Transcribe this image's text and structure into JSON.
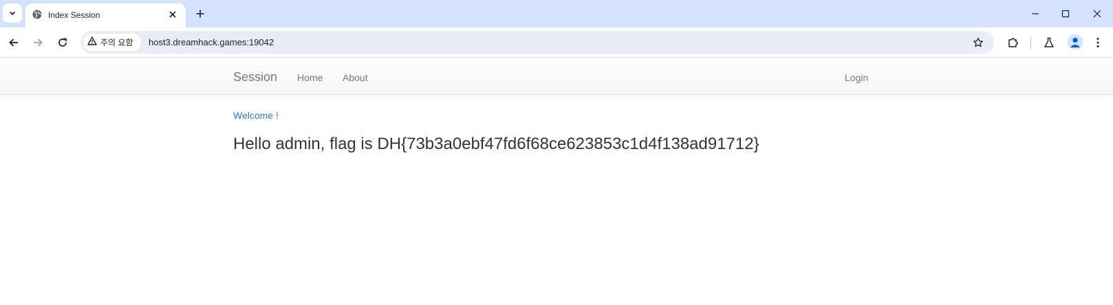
{
  "browser": {
    "tab": {
      "title": "Index Session"
    },
    "security_chip": {
      "label": "주의 요함"
    },
    "address": {
      "url": "host3.dreamhack.games:19042"
    }
  },
  "page": {
    "navbar": {
      "brand": "Session",
      "links": [
        "Home",
        "About"
      ],
      "login": "Login"
    },
    "welcome": "Welcome !",
    "message": "Hello admin, flag is DH{73b3a0ebf47fd6f68ce623853c1d4f138ad91712}"
  },
  "colors": {
    "tabstrip": "#d3e3fd",
    "omnibox": "#e9eef6",
    "link": "#337ab7",
    "nav_text": "#777777",
    "body_text": "#333333"
  },
  "icons": [
    "tab-list-icon",
    "globe-icon",
    "close-icon",
    "plus-icon",
    "minimize-icon",
    "maximize-icon",
    "back-icon",
    "forward-icon",
    "reload-icon",
    "warning-icon",
    "star-icon",
    "extensions-icon",
    "labs-icon",
    "profile-icon",
    "menu-icon"
  ]
}
